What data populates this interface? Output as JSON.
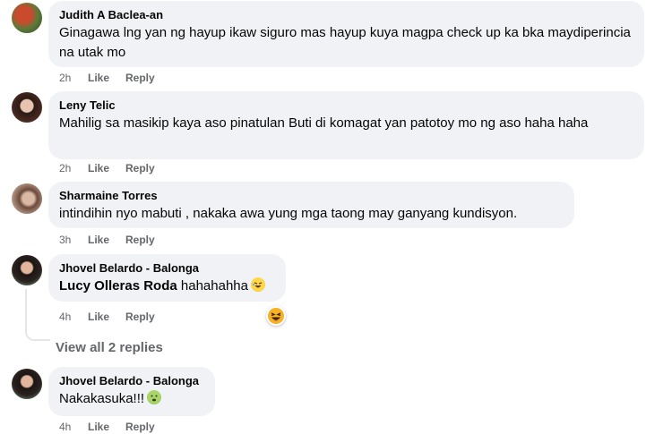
{
  "comments": [
    {
      "author": "Judith A Baclea-an",
      "text": "Ginagawa lng yan ng hayup ikaw siguro mas hayup kuya magpa check up ka bka maydiperincia na utak mo",
      "time": "2h",
      "like": "Like",
      "reply": "Reply"
    },
    {
      "author": "Leny Telic",
      "text": "Mahilig sa masikip kaya aso pinatulan Buti di komagat yan patotoy mo ng aso haha haha",
      "time": "2h",
      "like": "Like",
      "reply": "Reply"
    },
    {
      "author": "Sharmaine Torres",
      "text": "intindihin nyo mabuti , nakaka awa yung mga taong may ganyang kundisyon.",
      "time": "3h",
      "like": "Like",
      "reply": "Reply"
    },
    {
      "author": "Jhovel Belardo - Balonga",
      "mention": "Lucy Olleras Roda",
      "text": "hahahahha",
      "emoji": "rolling-laughing-emoji",
      "time": "4h",
      "like": "Like",
      "reply": "Reply"
    },
    {
      "author": "Jhovel Belardo - Balonga",
      "text": "Nakakasuka!!!",
      "emoji": "nauseated-face-emoji",
      "time": "4h",
      "like": "Like",
      "reply": "Reply"
    }
  ],
  "view_replies": "View all 2 replies",
  "reaction_icon": "haha-reaction-icon",
  "colors": {
    "bubble": "#f0f2f5",
    "meta": "#65676b",
    "text": "#050505"
  }
}
